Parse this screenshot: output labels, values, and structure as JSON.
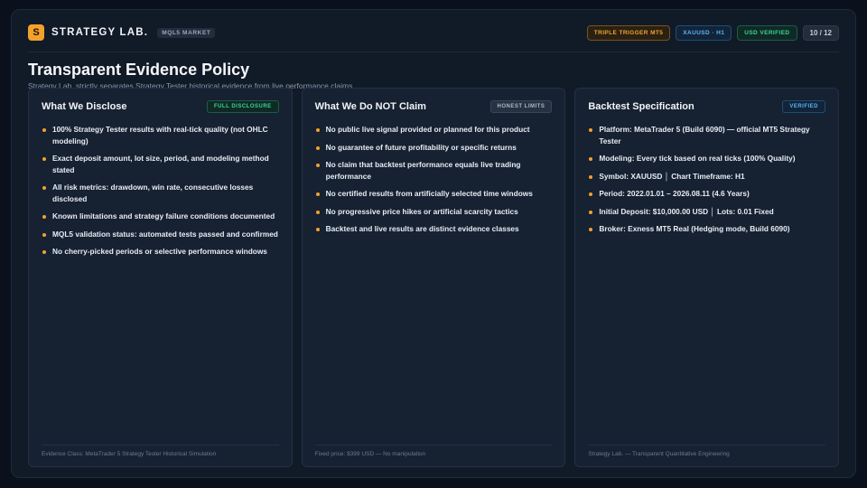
{
  "header": {
    "logo_letter": "S",
    "brand": "STRATEGY LAB.",
    "market_tag": "MQL5 MARKET",
    "badges": [
      "TRIPLE TRIGGER MT5",
      "XAUUSD · H1",
      "USD VERIFIED"
    ],
    "page_count": "10 / 12"
  },
  "title": "Transparent Evidence Policy",
  "subtitle": "Strategy Lab. strictly separates Strategy Tester historical evidence from live performance claims",
  "cards": [
    {
      "title": "What We Disclose",
      "tag": "FULL DISCLOSURE",
      "items": [
        "100% Strategy Tester results with real-tick quality (not OHLC modeling)",
        "Exact deposit amount, lot size, period, and modeling method stated",
        "All risk metrics: drawdown, win rate, consecutive losses disclosed",
        "Known limitations and strategy failure conditions documented",
        "MQL5 validation status: automated tests passed and confirmed",
        "No cherry-picked periods or selective performance windows"
      ],
      "footer": "Evidence Class: MetaTrader 5 Strategy Tester Historical Simulation"
    },
    {
      "title": "What We Do NOT Claim",
      "tag": "HONEST LIMITS",
      "items": [
        "No public live signal provided or planned for this product",
        "No guarantee of future profitability or specific returns",
        "No claim that backtest performance equals live trading performance",
        "No certified results from artificially selected time windows",
        "No progressive price hikes or artificial scarcity tactics",
        "Backtest and live results are distinct evidence classes"
      ],
      "footer": "Fixed price: $399 USD — No manipulation"
    },
    {
      "title": "Backtest Specification",
      "tag": "VERIFIED",
      "items": [
        "Platform: MetaTrader 5 (Build 6090) — official MT5 Strategy Tester",
        "Modeling: Every tick based on real ticks (100% Quality)",
        "Symbol: XAUUSD  │  Chart Timeframe: H1",
        "Period: 2022.01.01 – 2026.08.11 (4.6 Years)",
        "Initial Deposit: $10,000.00 USD  │  Lots: 0.01 Fixed",
        "Broker: Exness MT5 Real (Hedging mode, Build 6090)"
      ],
      "footer": "Strategy Lab. — Transparent Quantitative Engineering"
    }
  ],
  "colors": {
    "accent": "#f2a22c",
    "green": "#3dd39c",
    "blue": "#5eb5f4",
    "background": "#111a27",
    "card": "#162132"
  }
}
